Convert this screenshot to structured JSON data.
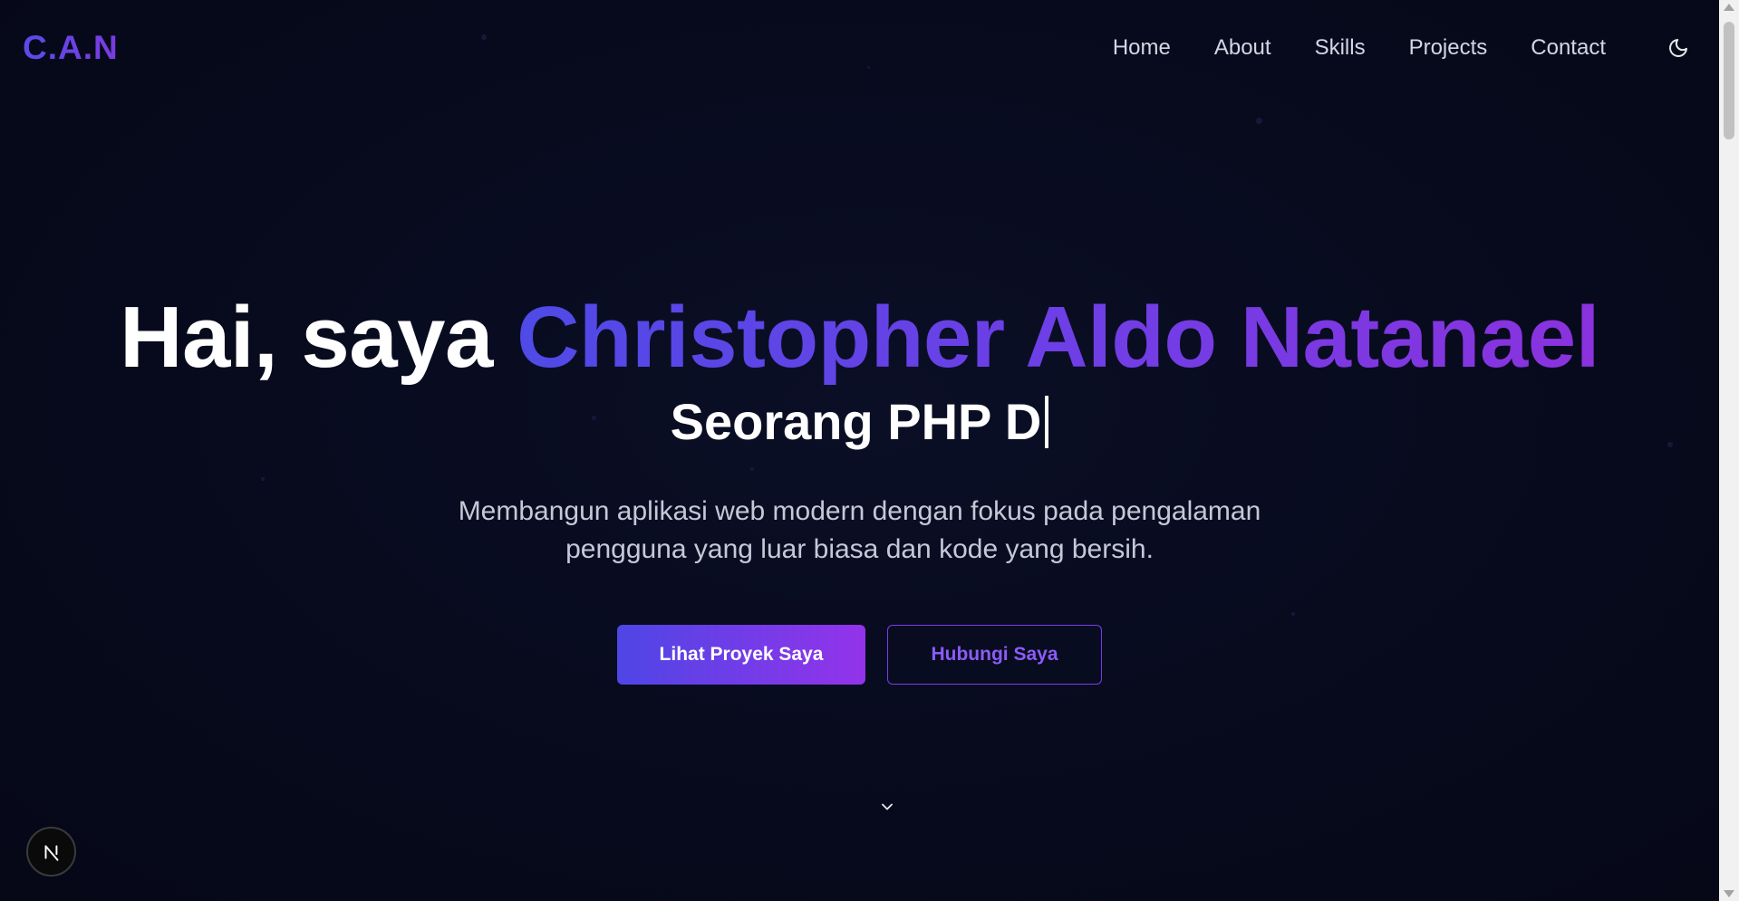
{
  "navbar": {
    "logo": "C.A.N",
    "links": [
      "Home",
      "About",
      "Skills",
      "Projects",
      "Contact"
    ],
    "theme_icon": "moon-icon"
  },
  "hero": {
    "greeting_prefix": "Hai, saya ",
    "name": "Christopher Aldo Natanael",
    "typed_text": "Seorang PHP D",
    "subtitle_line1": "Membangun aplikasi web modern dengan fokus pada pengalaman",
    "subtitle_line2": "pengguna yang luar biasa dan kode yang bersih.",
    "primary_button": "Lihat Proyek Saya",
    "secondary_button": "Hubungi Saya",
    "scroll_icon": "chevron-down-icon"
  },
  "badge": {
    "letter": "N"
  },
  "colors": {
    "background": "#070a1c",
    "accent_start": "#4f46e5",
    "accent_end": "#9333ea"
  }
}
